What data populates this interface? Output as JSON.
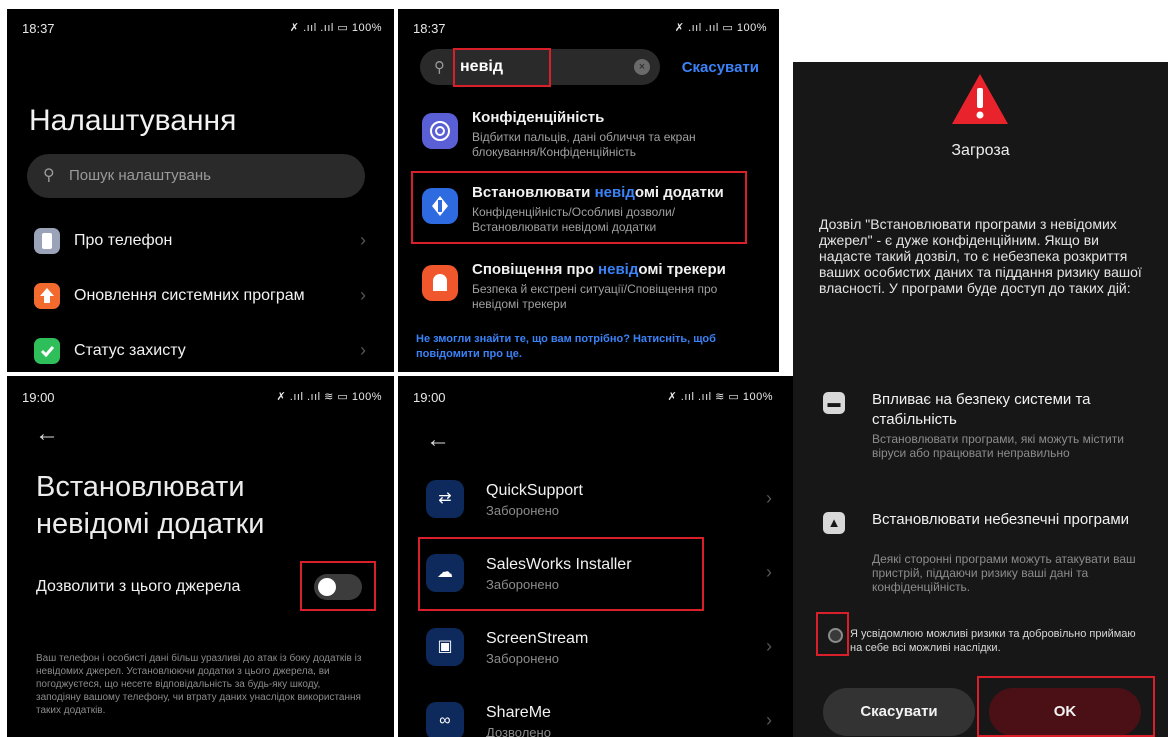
{
  "panel1": {
    "time": "18:37",
    "status_right": "✗ .ııl .ııl ▭ 100%",
    "title": "Налаштування",
    "search_placeholder": "Пошук налаштувань",
    "items": [
      {
        "label": "Про телефон",
        "icon": "phone-icon",
        "color": "#9aa3b8"
      },
      {
        "label": "Оновлення системних програм",
        "icon": "update-arrow-icon",
        "color": "#f26a2e"
      },
      {
        "label": "Статус захисту",
        "icon": "shield-check-icon",
        "color": "#2fbf5a"
      }
    ]
  },
  "panel2": {
    "time": "18:37",
    "status_right": "✗ .ııl .ııl ▭ 100%",
    "query": "невід",
    "cancel": "Скасувати",
    "results": [
      {
        "icon": "privacy-icon",
        "color": "#5a5fd6",
        "title_pre": "Конфіденційність",
        "title_hl": "",
        "title_post": "",
        "sub": "Відбитки пальців, дані обличчя та екран блокування/Конфіденційність"
      },
      {
        "icon": "install-unknown-icon",
        "color": "#2f6be0",
        "title_pre": "Встановлювати ",
        "title_hl": "невід",
        "title_post": "омі додатки",
        "sub": "Конфіденційність/Особливі дозволи/ Встановлювати невідомі додатки"
      },
      {
        "icon": "tracker-icon",
        "color": "#f0572c",
        "title_pre": "Сповіщення про ",
        "title_hl": "невід",
        "title_post": "омі трекери",
        "sub": "Безпека й екстрені ситуації/Сповіщення про невідомі трекери"
      }
    ],
    "not_found": "Не змогли знайти те, що вам потрібно? Натисніть, щоб повідомити про це."
  },
  "panel3": {
    "time": "19:00",
    "status_right": "✗ .ııl .ııl ≋ ▭ 100%",
    "title_line1": "Встановлювати",
    "title_line2": "невідомі додатки",
    "allow_label": "Дозволити з цього джерела",
    "toggle_on": false,
    "warning": "Ваш телефон і особисті дані більш уразливі до атак із боку додатків із невідомих джерел. Установлюючи додатки з цього джерела, ви погоджуєтеся, що несете відповідальність за будь-яку шкоду, заподіяну вашому телефону, чи втрату даних унаслідок використання таких додатків."
  },
  "panel4": {
    "time": "19:00",
    "status_right": "✗ .ııl .ııl ≋ ▭ 100%",
    "apps": [
      {
        "name": "QuickSupport",
        "status": "Заборонено",
        "icon": "quicksupport-icon",
        "glyph": "⇄"
      },
      {
        "name": "SalesWorks Installer",
        "status": "Заборонено",
        "icon": "cloud-upload-icon",
        "glyph": "☁"
      },
      {
        "name": "ScreenStream",
        "status": "Заборонено",
        "icon": "screenstream-icon",
        "glyph": "▣"
      },
      {
        "name": "ShareMe",
        "status": "Дозволено",
        "icon": "shareme-icon",
        "glyph": "∞"
      }
    ]
  },
  "panel5": {
    "threat_title": "Загроза",
    "body": "Дозвіл \"Встановлювати програми з невідомих джерел\" - є дуже конфіденційним. Якщо ви надасте такий дозвіл, то є небезпека розкриття ваших особистих даних та піддання ризику вашої власності. У програми буде доступ до таких дій:",
    "perm1_title": "Впливає на безпеку системи та стабільність",
    "perm1_sub": "Встановлювати програми, які можуть містити віруси або працювати неправильно",
    "perm2_title": "Встановлювати небезпечні програми",
    "perm2_sub": "Деякі сторонні програми можуть атакувати ваш пристрій, піддаючи ризику ваші дані та конфіденційність.",
    "ack": "Я усвідомлюю можливі ризики та добровільно приймаю на себе всі можливі наслідки.",
    "cancel": "Скасувати",
    "ok": "OK"
  }
}
